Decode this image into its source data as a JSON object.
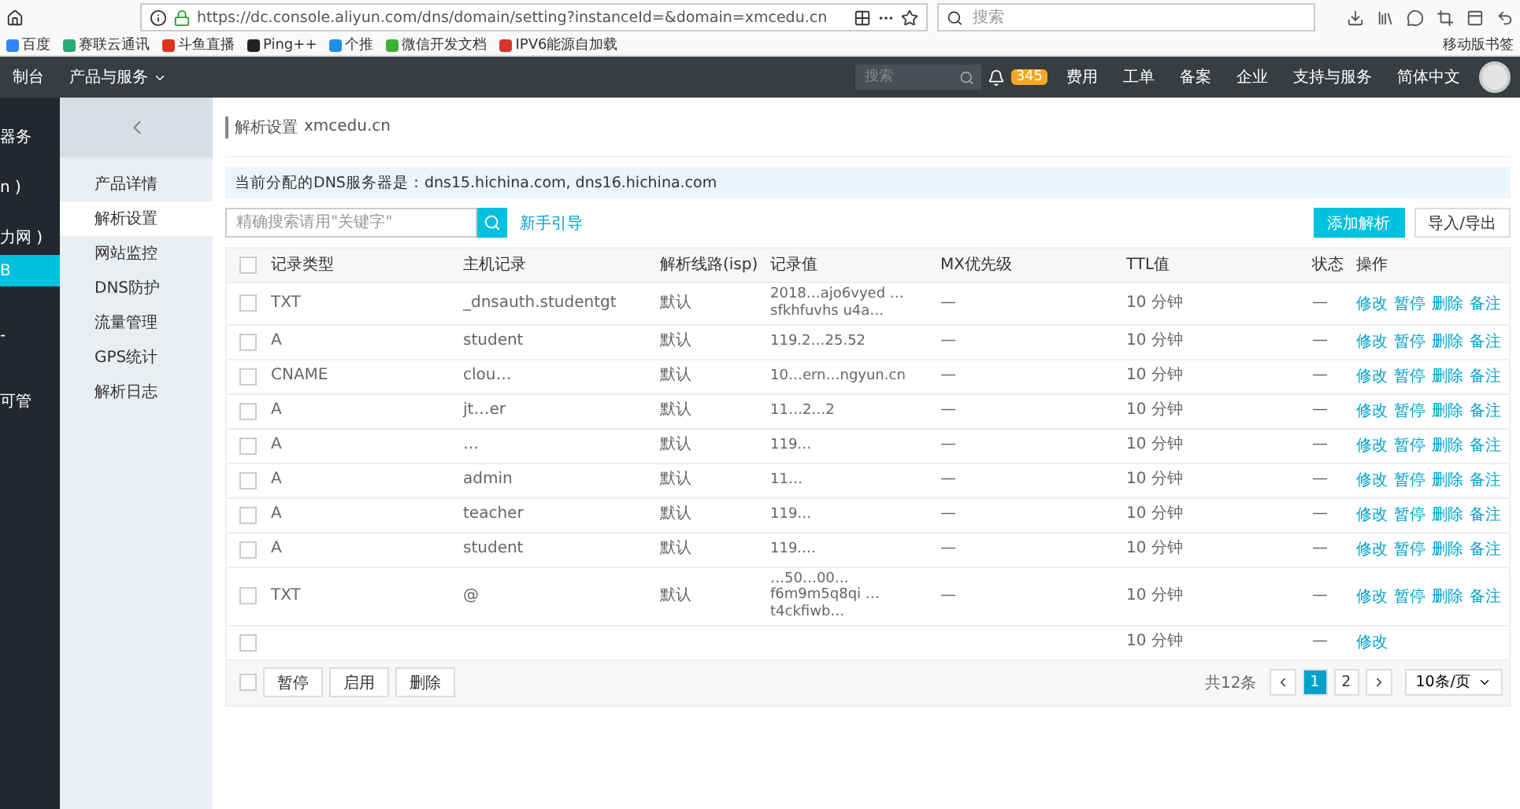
{
  "browser": {
    "url": "https://dc.console.aliyun.com/dns/domain/setting?instanceId=&domain=xmcedu.cn",
    "search": {
      "placeholder": "搜索"
    },
    "bookmarks": [
      {
        "label": "百度",
        "color": "#3385ff"
      },
      {
        "label": "赛联云通讯",
        "color": "#2aa876"
      },
      {
        "label": "斗鱼直播",
        "color": "#e0301e"
      },
      {
        "label": "Ping++",
        "color": "#222222"
      },
      {
        "label": "个推",
        "color": "#1f8fe6"
      },
      {
        "label": "微信开发文档",
        "color": "#3cb034"
      },
      {
        "label": "IPV6能源自加载",
        "color": "#d9342b"
      }
    ],
    "mobile_bookmarks": "移动版书签"
  },
  "topbar": {
    "console": "制台",
    "products": "产品与服务",
    "search": {
      "placeholder": "搜索"
    },
    "badge": "345",
    "links": [
      "费用",
      "工单",
      "备案",
      "企业",
      "支持与服务",
      "简体中文"
    ]
  },
  "sidebar": {
    "items": [
      {
        "label": "器务",
        "selected": false
      },
      {
        "label": "n )",
        "selected": false
      },
      {
        "label": "力网 )",
        "selected": false
      },
      {
        "label": "B",
        "selected": true
      },
      {
        "label": "-",
        "selected": false
      },
      {
        "label": "可管",
        "selected": false
      }
    ]
  },
  "subnav": {
    "items": [
      {
        "label": "产品详情",
        "selected": false
      },
      {
        "label": "解析设置",
        "selected": true
      },
      {
        "label": "网站监控",
        "selected": false
      },
      {
        "label": "DNS防护",
        "selected": false
      },
      {
        "label": "流量管理",
        "selected": false
      },
      {
        "label": "GPS统计",
        "selected": false
      },
      {
        "label": "解析日志",
        "selected": false
      }
    ]
  },
  "page": {
    "title": "解析设置",
    "domain": "xmcedu.cn",
    "info": "当前分配的DNS服务器是：dns15.hichina.com, dns16.hichina.com",
    "search": {
      "placeholder": "精确搜索请用\"关键字\""
    },
    "guide": "新手引导",
    "add_button": "添加解析",
    "import_button": "导入/导出"
  },
  "table": {
    "header_checked": false,
    "columns": [
      "记录类型",
      "主机记录",
      "解析线路(isp)",
      "记录值",
      "MX优先级",
      "TTL值",
      "状态",
      "操作"
    ],
    "rows": [
      {
        "checked": false,
        "cells": [
          "TXT",
          "_dnsauth.studentgt",
          "默认",
          "2018…ajo6vyed …sfkhfuvhs u4a…",
          "—",
          "10 分钟",
          "—"
        ],
        "actions": [
          "修改",
          "暂停",
          "删除",
          "备注"
        ]
      },
      {
        "checked": false,
        "cells": [
          "A",
          "student",
          "默认",
          "119.2…25.52",
          "—",
          "10 分钟",
          "—"
        ],
        "actions": [
          "修改",
          "暂停",
          "删除",
          "备注"
        ]
      },
      {
        "checked": false,
        "cells": [
          "CNAME",
          "clou…",
          "默认",
          "10…ern…ngyun.cn",
          "—",
          "10 分钟",
          "—"
        ],
        "actions": [
          "修改",
          "暂停",
          "删除",
          "备注"
        ]
      },
      {
        "checked": false,
        "cells": [
          "A",
          "jt…er",
          "默认",
          "11…2…2",
          "—",
          "10 分钟",
          "—"
        ],
        "actions": [
          "修改",
          "暂停",
          "删除",
          "备注"
        ]
      },
      {
        "checked": false,
        "cells": [
          "A",
          "…",
          "默认",
          "119…",
          "—",
          "10 分钟",
          "—"
        ],
        "actions": [
          "修改",
          "暂停",
          "删除",
          "备注"
        ]
      },
      {
        "checked": false,
        "cells": [
          "A",
          "admin",
          "默认",
          "11…",
          "—",
          "10 分钟",
          "—"
        ],
        "actions": [
          "修改",
          "暂停",
          "删除",
          "备注"
        ]
      },
      {
        "checked": false,
        "cells": [
          "A",
          "teacher",
          "默认",
          "119…",
          "—",
          "10 分钟",
          "—"
        ],
        "actions": [
          "修改",
          "暂停",
          "删除",
          "备注"
        ]
      },
      {
        "checked": false,
        "cells": [
          "A",
          "student",
          "默认",
          "119.…",
          "—",
          "10 分钟",
          "—"
        ],
        "actions": [
          "修改",
          "暂停",
          "删除",
          "备注"
        ]
      },
      {
        "checked": false,
        "cells": [
          "TXT",
          "@",
          "默认",
          "…50…00…f6m9m5q8qi …t4ckfiwb…",
          "—",
          "10 分钟",
          "—"
        ],
        "actions": [
          "修改",
          "暂停",
          "删除",
          "备注"
        ]
      },
      {
        "checked": false,
        "cells": [
          "",
          "",
          "",
          "",
          "",
          "10 分钟",
          "—"
        ],
        "actions": [
          "修改"
        ]
      }
    ]
  },
  "footer": {
    "checked": false,
    "buttons": [
      "暂停",
      "启用",
      "删除"
    ],
    "total": "共12条",
    "pages": [
      {
        "label": "1",
        "selected": true
      },
      {
        "label": "2",
        "selected": false
      }
    ],
    "page_size": "10条/页"
  }
}
